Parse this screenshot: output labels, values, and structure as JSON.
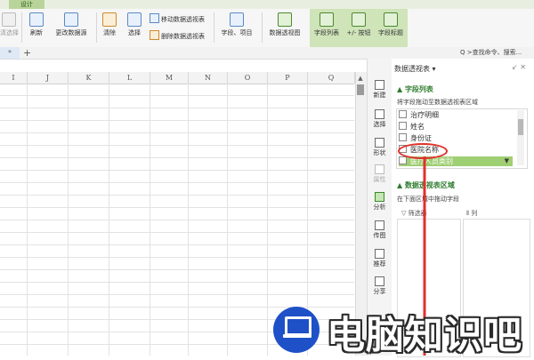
{
  "tabs": {
    "design": "设计"
  },
  "ribbon": {
    "left_clipped": "清选择",
    "refresh": "刷新",
    "change_source": "更改数据源",
    "move_pivot": "移动数据透视表",
    "clear": "清除",
    "select": "选择",
    "delete_pivot": "删除数据透视表",
    "fields_items": "字段、项目",
    "pivot_chart": "数据透视图",
    "field_list": "字段列表",
    "buttons": "+/- 按钮",
    "field_headers": "字段标题"
  },
  "tabbar": {
    "doc_tab": "*",
    "add": "+",
    "search_text": "Q >查找命令、搜索..."
  },
  "columns": [
    "I",
    "J",
    "K",
    "L",
    "M",
    "N",
    "O",
    "P",
    "Q"
  ],
  "sidebar": {
    "items": [
      {
        "label": "新建",
        "icon": "new-icon"
      },
      {
        "label": "选择",
        "icon": "select-icon"
      },
      {
        "label": "形状",
        "icon": "shape-icon"
      },
      {
        "label": "属性",
        "icon": "property-icon"
      },
      {
        "label": "分析",
        "icon": "analyze-icon"
      },
      {
        "label": "传图",
        "icon": "image-icon"
      },
      {
        "label": "推荐",
        "icon": "recommend-icon"
      },
      {
        "label": "分享",
        "icon": "share-icon"
      }
    ]
  },
  "panel": {
    "title": "数据透视表 ▾",
    "close": "↙ ✕",
    "field_section": "▲ 字段列表",
    "field_hint": "将字段拖动至数据透视表区域",
    "fields": [
      {
        "label": "治疗明细",
        "selected": false
      },
      {
        "label": "姓名",
        "selected": false
      },
      {
        "label": "身份证",
        "selected": false
      },
      {
        "label": "医院名称",
        "selected": false
      },
      {
        "label": "医疗人员类别",
        "selected": true
      }
    ],
    "area_section": "▲ 数据透视表区域",
    "area_hint": "在下面区域中拖动字段",
    "filter_label": "筛选器",
    "column_label": "列"
  },
  "watermark": {
    "text": "电脑知识吧",
    "color": "#1e50c8"
  },
  "colors": {
    "accent_green": "#9fcf73",
    "annotation_red": "#e0312c"
  }
}
